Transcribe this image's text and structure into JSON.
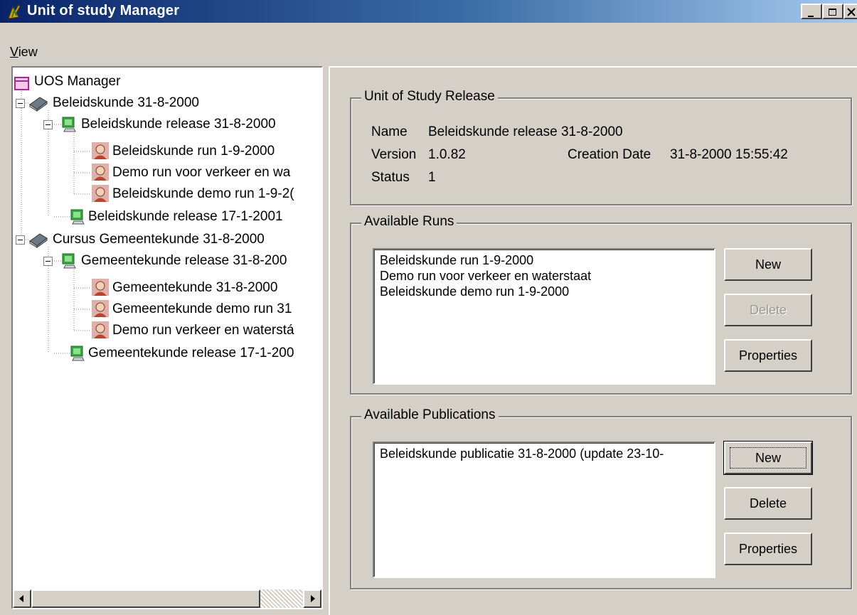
{
  "window": {
    "title": "Unit of study Manager",
    "controls": [
      "minimize-icon",
      "maximize-icon",
      "close-icon"
    ]
  },
  "menu": {
    "view_first": "V",
    "view_rest": "iew"
  },
  "tree": {
    "root": "UOS Manager",
    "course1": "Beleidskunde 31-8-2000",
    "release1": "Beleidskunde release 31-8-2000",
    "run1": "Beleidskunde run 1-9-2000",
    "run2": "Demo run voor verkeer en wa",
    "run3": "Beleidskunde demo run 1-9-2(",
    "release2": "Beleidskunde release 17-1-2001",
    "course2": "Cursus Gemeentekunde 31-8-2000",
    "release3": "Gemeentekunde release 31-8-200",
    "run4": "Gemeentekunde 31-8-2000",
    "run5": "Gemeentekunde demo run 31",
    "run6": "Demo run verkeer en waterstá",
    "release4": "Gemeentekunde release 17-1-200"
  },
  "release": {
    "caption": "Unit of Study Release",
    "name_label": "Name",
    "name_value": "Beleidskunde release 31-8-2000",
    "version_label": "Version",
    "version_value": "1.0.82",
    "creation_label": "Creation Date",
    "creation_value": "31-8-2000 15:55:42",
    "status_label": "Status",
    "status_value": "1"
  },
  "runs": {
    "caption": "Available Runs",
    "items": [
      "Beleidskunde run 1-9-2000",
      "Demo run voor verkeer en waterstaat",
      "Beleidskunde demo run 1-9-2000"
    ],
    "new": "New",
    "delete": "Delete",
    "properties": "Properties",
    "delete_enabled": false
  },
  "publications": {
    "caption": "Available Publications",
    "items": [
      "Beleidskunde publicatie 31-8-2000 (update 23-10-"
    ],
    "new": "New",
    "delete": "Delete",
    "properties": "Properties"
  },
  "icons": {
    "app": "app-icon",
    "root": "folder-icon",
    "course": "book-icon",
    "release": "computer-icon",
    "run": "person-icon"
  },
  "colors": {
    "titlebar_start": "#0a246a",
    "titlebar_end": "#a6caf0",
    "face": "#d4d0c8"
  }
}
